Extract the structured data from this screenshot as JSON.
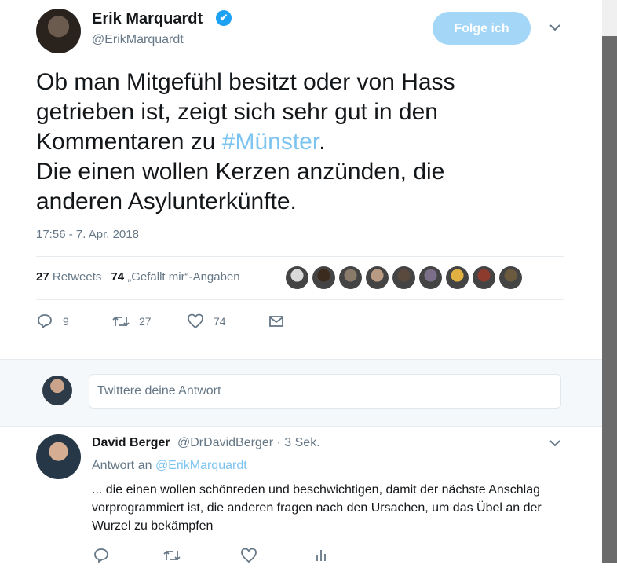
{
  "tweet": {
    "author_name": "Erik Marquardt",
    "author_handle": "@ErikMarquardt",
    "verified_mark": "✔",
    "follow_label": "Folge ich",
    "text_line1": "Ob man Mitgefühl besitzt oder von Hass",
    "text_line2": "getrieben ist, zeigt sich sehr gut in den",
    "text_line3_pre": "Kommentaren zu ",
    "hashtag": "#Münster",
    "text_line3_post": ".",
    "text_line4": "Die einen wollen Kerzen anzünden, die",
    "text_line5": "anderen Asylunterkünfte.",
    "timestamp": "17:56 - 7. Apr. 2018",
    "retweet_count": "27",
    "retweet_label": "Retweets",
    "like_count": "74",
    "like_label": "„Gefällt mir“-Angaben",
    "action_reply_count": "9",
    "action_retweet_count": "27",
    "action_like_count": "74",
    "likers": [
      "#d9d9d9",
      "#3b2a1e",
      "#8a7a6a",
      "#b89b82",
      "#5a4a3e",
      "#7a6e88",
      "#e0b040",
      "#8c3b2c",
      "#6b5a3e"
    ]
  },
  "reply_box": {
    "placeholder": "Twittere deine Antwort"
  },
  "reply": {
    "author_name": "David Berger",
    "meta": "@DrDavidBerger · 3 Sek.",
    "reply_to_label": "Antwort an ",
    "reply_to_handle": "@ErikMarquardt",
    "text": "... die einen wollen schönreden und beschwichtigen, damit der nächste Anschlag vorprogrammiert ist, die anderen fragen nach den Ursachen, um das Übel an der Wurzel zu bekämpfen"
  },
  "icons": {
    "reply": "reply-icon",
    "retweet": "retweet-icon",
    "like": "heart-icon",
    "dm": "envelope-icon",
    "analytics": "bar-chart-icon",
    "caret": "chevron-down-icon"
  },
  "colors": {
    "accent": "#1da1f2",
    "follow_bg": "#a3d6f7",
    "hashtag": "#7ec4f0",
    "muted": "#657786"
  }
}
